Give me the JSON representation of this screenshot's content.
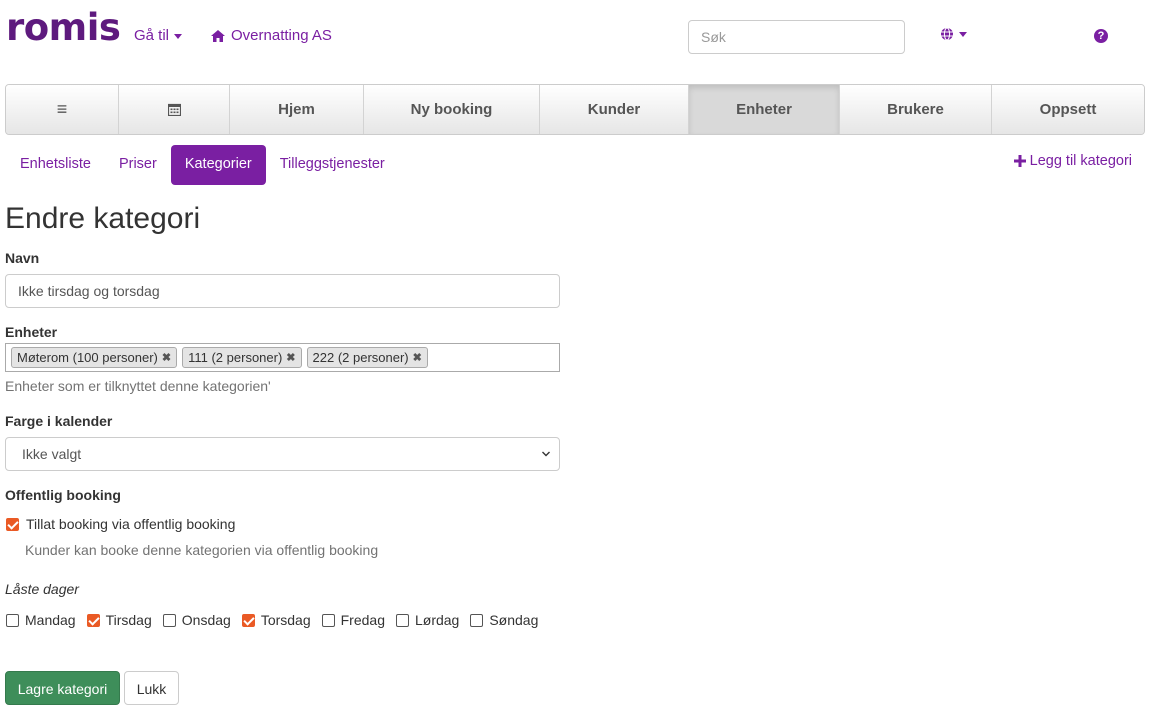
{
  "header": {
    "logo": "romis",
    "goto_label": "Gå til",
    "company": "Overnatting AS",
    "search_placeholder": "Søk",
    "help_glyph": "?"
  },
  "mainnav": {
    "items": [
      {
        "label": "≡",
        "icon": "menu-icon"
      },
      {
        "label": "",
        "icon": "calendar-icon"
      },
      {
        "label": "Hjem"
      },
      {
        "label": "Ny booking"
      },
      {
        "label": "Kunder"
      },
      {
        "label": "Enheter",
        "active": true
      },
      {
        "label": "Brukere"
      },
      {
        "label": "Oppsett"
      }
    ]
  },
  "subnav": {
    "tabs": [
      "Enhetsliste",
      "Priser",
      "Kategorier",
      "Tilleggstjenester"
    ],
    "active": "Kategorier",
    "add_label": "Legg til kategori"
  },
  "form": {
    "title": "Endre kategori",
    "name_label": "Navn",
    "name_value": "Ikke tirsdag og torsdag",
    "units_label": "Enheter",
    "units": [
      "Møterom (100 personer)",
      "111 (2 personer)",
      "222 (2 personer)"
    ],
    "units_help": "Enheter som er tilknyttet denne kategorien'",
    "color_label": "Farge i kalender",
    "color_value": "Ikke valgt",
    "public_label": "Offentlig booking",
    "public_checkbox_label": "Tillat booking via offentlig booking",
    "public_checked": true,
    "public_help": "Kunder kan booke denne kategorien via offentlig booking",
    "locked_days_label": "Låste dager",
    "days": [
      {
        "label": "Mandag",
        "checked": false
      },
      {
        "label": "Tirsdag",
        "checked": true
      },
      {
        "label": "Onsdag",
        "checked": false
      },
      {
        "label": "Torsdag",
        "checked": true
      },
      {
        "label": "Fredag",
        "checked": false
      },
      {
        "label": "Lørdag",
        "checked": false
      },
      {
        "label": "Søndag",
        "checked": false
      }
    ],
    "save_label": "Lagre kategori",
    "close_label": "Lukk"
  },
  "colors": {
    "accent": "#7a1fa2",
    "logo": "#5e1a7e",
    "checkbox": "#ea5a25",
    "save": "#3e8e5a"
  }
}
